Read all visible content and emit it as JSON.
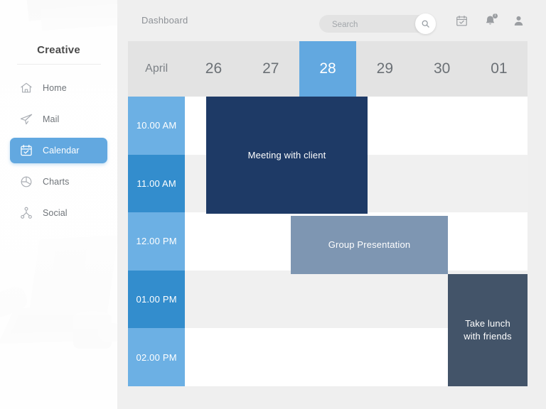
{
  "app": {
    "brand": "Creative"
  },
  "sidebar": {
    "items": [
      {
        "label": "Home",
        "icon": "home-icon",
        "active": false
      },
      {
        "label": "Mail",
        "icon": "paper-plane-icon",
        "active": false
      },
      {
        "label": "Calendar",
        "icon": "calendar-icon",
        "active": true
      },
      {
        "label": "Charts",
        "icon": "pie-chart-icon",
        "active": false
      },
      {
        "label": "Social",
        "icon": "share-nodes-icon",
        "active": false
      }
    ]
  },
  "header": {
    "title": "Dashboard",
    "search": {
      "placeholder": "Search",
      "value": "",
      "icon": "search-icon"
    },
    "icons": [
      {
        "name": "calendar-check-icon",
        "badge": ""
      },
      {
        "name": "bell-icon",
        "badge": "1"
      },
      {
        "name": "user-icon",
        "badge": ""
      }
    ]
  },
  "calendar": {
    "month": "April",
    "days": [
      {
        "label": "26",
        "today": false
      },
      {
        "label": "27",
        "today": false
      },
      {
        "label": "28",
        "today": true
      },
      {
        "label": "29",
        "today": false
      },
      {
        "label": "30",
        "today": false
      },
      {
        "label": "01",
        "today": false
      }
    ],
    "times": [
      "10.00 AM",
      "11.00 AM",
      "12.00 PM",
      "01.00 PM",
      "02.00 PM"
    ],
    "events": [
      {
        "title": "Meeting with client",
        "start_time": "10.00 AM",
        "end_time": "11.00 AM",
        "day": "27",
        "day_span": 2,
        "row_start": 0,
        "row_span": 2,
        "col_start": 1,
        "color": "#1e3a66",
        "style": "meeting"
      },
      {
        "title": "Group Presentation",
        "start_time": "12.00 PM",
        "end_time": "12.00 PM",
        "day": "28",
        "day_span": 2,
        "row_start": 2,
        "row_span": 1,
        "col_start": 3,
        "color": "#7e96b2",
        "style": "presentation"
      },
      {
        "title": "Take lunch\nwith friends",
        "title_line1": "Take lunch",
        "title_line2": "with friends",
        "start_time": "01.00 PM",
        "end_time": "02.00 PM",
        "day": "01",
        "day_span": 1,
        "row_start": 3,
        "row_span": 2,
        "col_start": 6,
        "color": "#435469",
        "style": "lunch"
      }
    ]
  },
  "colors": {
    "accent": "#62a8e0",
    "time_light": "#6cb0e4",
    "time_dark": "#338dcd",
    "header_bg": "#e3e3e3",
    "panel_bg": "#efefef",
    "row_alt": "#f0f0f0"
  }
}
